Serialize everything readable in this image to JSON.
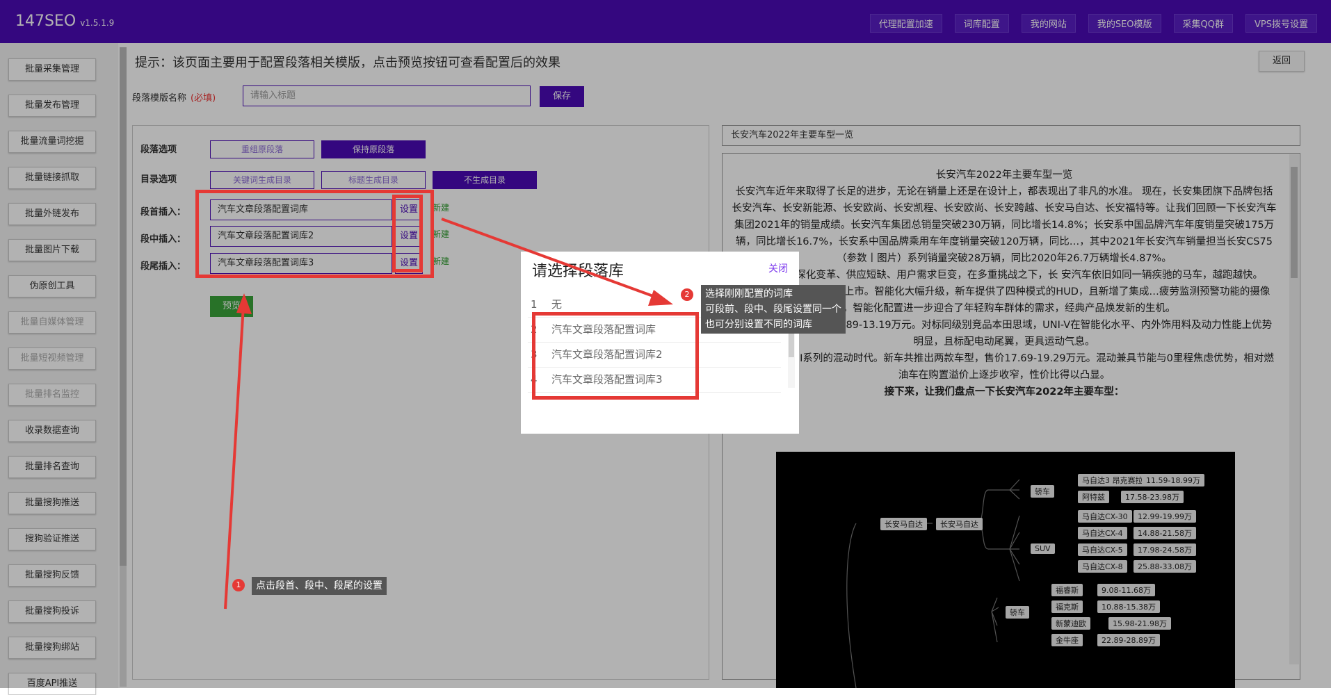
{
  "app": {
    "name": "147SEO",
    "version": "v1.5.1.9"
  },
  "topnav": [
    "代理配置加速",
    "词库配置",
    "我的网站",
    "我的SEO模版",
    "采集QQ群",
    "VPS拨号设置"
  ],
  "sidebar": [
    "批量采集管理",
    "批量发布管理",
    "批量流量词挖掘",
    "批量链接抓取",
    "批量外链发布",
    "批量图片下载",
    "伪原创工具",
    "批量自媒体管理",
    "批量短视频管理",
    "批量排名监控",
    "收录数据查询",
    "批量排名查询",
    "批量搜狗推送",
    "搜狗验证推送",
    "批量搜狗反馈",
    "批量搜狗投诉",
    "批量搜狗绑站",
    "百度API推送"
  ],
  "hint": "提示：该页面主要用于配置段落相关模版，点击预览按钮可查看配置后的效果",
  "back_label": "返回",
  "name_label": "段落模版名称",
  "required": "(必填)",
  "name_placeholder": "请输入标题",
  "save_label": "保存",
  "para_options": {
    "label": "段落选项",
    "opt1": "重组原段落",
    "opt2": "保持原段落"
  },
  "toc_options": {
    "label": "目录选项",
    "opt1": "关键词生成目录",
    "opt2": "标题生成目录",
    "opt3": "不生成目录"
  },
  "inserts": [
    {
      "label": "段首插入：",
      "value": "汽车文章段落配置词库",
      "set": "设置",
      "new": "新建"
    },
    {
      "label": "段中插入：",
      "value": "汽车文章段落配置词库2",
      "set": "设置",
      "new": "新建"
    },
    {
      "label": "段尾插入：",
      "value": "汽车文章段落配置词库3",
      "set": "设置",
      "new": "新建"
    }
  ],
  "preview_label": "预览",
  "right_title": "长安汽车2022年主要车型一览",
  "article": {
    "heading": "长安汽车2022年主要车型一览",
    "p1": "长安汽车近年来取得了长足的进步，无论在销量上还是在设计上，都表现出了非凡的水准。 现在，长安集团旗下品牌包括长安汽车、长安新能源、长安欧尚、长安凯程、长安欧尚、长安跨越、长安马自达、长安福特等。让我们回顾一下长安汽车集团2021年的销量成绩。长安汽车集团总销量突破230万辆，同比增长14.8%；长安系中国品牌汽车年度销量突破175万辆，同比增长16.7%，长安系中国品牌乘用车年度销量突破120万辆，同比…，其中2021年长安汽车销量担当长安CS75（参数丨图片）系列销量突破28万辆，同比2020年26.7万辆增长4.87%。",
    "p2": "…行业继续深化变革、供应短缺、用户需求巨变，在多重挑战之下，长 安汽车依旧如同一辆疾驰的马车，越跑越快。",
    "p3": "…标配8AT，已于2月底上市。智能化大幅升级，新车提供了四种模式的HUD，且新增了集成…疲劳监测预警功能的摄像头，智能化配置进一步迎合了年轻购车群体的需求，经典产品焕发新的生机。",
    "p4": "…I-V即将上市，定价10.89-13.19万元。对标同级别竞品本田思域，UNI-V在智能化水平、内外饰用料及动力性能上优势明显，且标配电动尾翼，更具运动气息。",
    "p5": "…市，开启UNI系列的混动时代。新车共推出两款车型，售价17.69-19.29万元。混动兼具节能与0里程焦虑优势，相对燃油车在购置溢价上逐步收窄，性价比得以凸显。",
    "sub": "接下来，让我们盘点一下长安汽车2022年主要车型："
  },
  "mindmap": {
    "root": "长安马自达",
    "brand": "长安马自达",
    "cat1": "轿车",
    "cat2": "SUV",
    "cat3": "轿车",
    "items": [
      {
        "name": "马自达3 昂克赛拉",
        "price": "11.59-18.99万"
      },
      {
        "name": "阿特兹",
        "price": "17.58-23.98万"
      },
      {
        "name": "马自达CX-30",
        "price": "12.99-19.99万"
      },
      {
        "name": "马自达CX-4",
        "price": "14.88-21.58万"
      },
      {
        "name": "马自达CX-5",
        "price": "17.98-24.58万"
      },
      {
        "name": "马自达CX-8",
        "price": "25.88-33.08万"
      },
      {
        "name": "福睿斯",
        "price": "9.08-11.68万"
      },
      {
        "name": "福克斯",
        "price": "10.88-15.38万"
      },
      {
        "name": "新蒙迪欧",
        "price": "15.98-21.98万"
      },
      {
        "name": "金牛座",
        "price": "22.89-28.89万"
      }
    ]
  },
  "modal": {
    "title": "请选择段落库",
    "close": "关闭",
    "items": [
      {
        "n": "1",
        "label": "无"
      },
      {
        "n": "2",
        "label": "汽车文章段落配置词库"
      },
      {
        "n": "3",
        "label": "汽车文章段落配置词库2"
      },
      {
        "n": "4",
        "label": "汽车文章段落配置词库3"
      }
    ]
  },
  "tip1": {
    "num": "1",
    "text": "点击段首、段中、段尾的设置"
  },
  "tip2": {
    "num": "2",
    "line1": "选择刚刚配置的词库",
    "line2": "可段前、段中、段尾设置同一个",
    "line3": "也可分别设置不同的词库"
  },
  "colors": {
    "brand": "#4b0bb7",
    "annotation": "#e53935",
    "preview": "#3aa43a"
  }
}
